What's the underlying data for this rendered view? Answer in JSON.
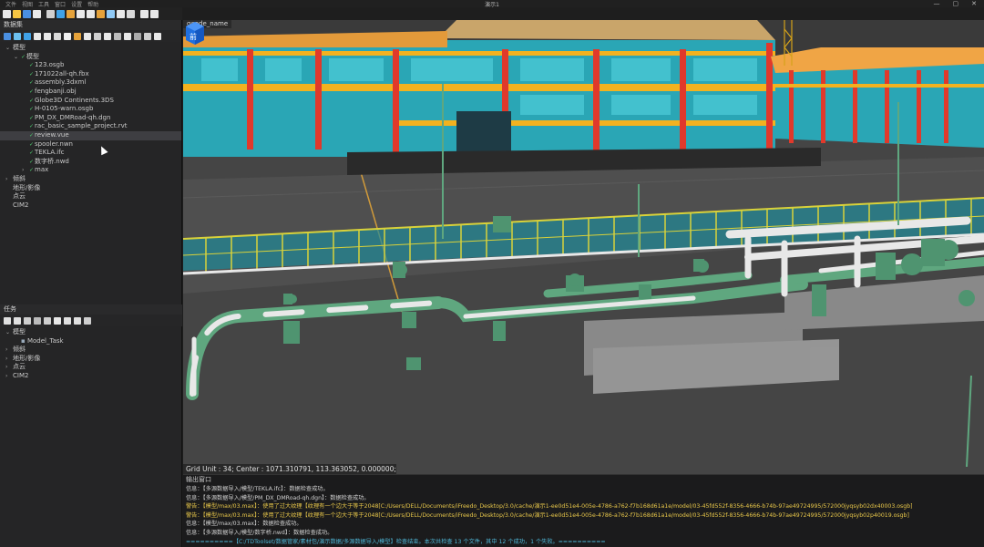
{
  "window": {
    "title": "演示1",
    "menus": [
      "文件",
      "视图",
      "工具",
      "窗口",
      "设置",
      "帮助"
    ],
    "controls": [
      "—",
      "▢",
      "✕"
    ]
  },
  "toolbar": {
    "icons": [
      "new-icon",
      "open-icon",
      "save-icon",
      "close-icon",
      "grid-icon",
      "globe-icon",
      "layers-icon",
      "doc-icon",
      "building-icon",
      "chart-icon",
      "image-icon",
      "edit-icon",
      "cube-icon",
      "settings-icon",
      "info-icon"
    ]
  },
  "dataset_panel": {
    "title": "数据集",
    "tree": [
      {
        "level": 0,
        "arrow": "⌄",
        "label": "模型"
      },
      {
        "level": 1,
        "arrow": "⌄",
        "label": "模型",
        "check": true
      },
      {
        "level": 2,
        "label": "123.osgb",
        "check": true
      },
      {
        "level": 2,
        "label": "171022all-qh.fbx",
        "check": true
      },
      {
        "level": 2,
        "label": "assembly.3dxml",
        "check": true
      },
      {
        "level": 2,
        "label": "fengbanji.obj",
        "check": true
      },
      {
        "level": 2,
        "label": "Globe3D Continents.3DS",
        "check": true
      },
      {
        "level": 2,
        "label": "H-0105-warn.osgb",
        "check": true
      },
      {
        "level": 2,
        "label": "PM_DX_DMRoad-qh.dgn",
        "check": true
      },
      {
        "level": 2,
        "label": "rac_basic_sample_project.rvt",
        "check": true
      },
      {
        "level": 2,
        "label": "review.vue",
        "check": true,
        "selected": true
      },
      {
        "level": 2,
        "label": "spooler.nwn",
        "check": true
      },
      {
        "level": 2,
        "label": "TEKLA.ifc",
        "check": true
      },
      {
        "level": 2,
        "label": "数字桥.nwd",
        "check": true
      },
      {
        "level": 2,
        "arrow": "›",
        "label": "max",
        "check": true
      },
      {
        "level": 0,
        "arrow": "›",
        "label": "倾斜"
      },
      {
        "level": 0,
        "arrow": "",
        "label": "地形/影像"
      },
      {
        "level": 0,
        "arrow": "",
        "label": "点云"
      },
      {
        "level": 0,
        "arrow": "",
        "label": "CIM2"
      }
    ]
  },
  "task_panel": {
    "title": "任务",
    "tree": [
      {
        "level": 0,
        "arrow": "⌄",
        "label": "模型"
      },
      {
        "level": 1,
        "arrow": "",
        "label": "Model_Task",
        "bullet": "▪"
      },
      {
        "level": 0,
        "arrow": "›",
        "label": "倾斜"
      },
      {
        "level": 0,
        "arrow": "›",
        "label": "地形/影像"
      },
      {
        "level": 0,
        "arrow": "›",
        "label": "点云"
      },
      {
        "level": 0,
        "arrow": "›",
        "label": "CIM2"
      }
    ]
  },
  "viewport": {
    "tab_label": "geode_name",
    "status": "Grid Unit : 34; Center : 1071.310791, 113.363052, 0.000000;",
    "navcube_face": "前"
  },
  "output": {
    "title": "输出窗口",
    "lines": [
      {
        "type": "info",
        "text": "信息：【多源数据导入/模型/TEKLA.ifc】：数据检查成功。"
      },
      {
        "type": "info",
        "text": "信息：【多源数据导入/模型/PM_DX_DMRoad-qh.dgn】：数据检查成功。"
      },
      {
        "type": "warn",
        "text": "警告：【模型/max/03.max】：使用了过大纹理【纹理有一个边大于等于2048[C:/Users/DELL/Documents/iFreedo_Desktop/3.0/cache/演示1-ee0d51e4-005e-4786-a762-f7b168d61a1e/model/03-45fd552f-8356-4666-b74b-97ae49724995/572000jyqsyb02dx40003.osgb]"
      },
      {
        "type": "warn",
        "text": "警告：【模型/max/03.max】：使用了过大纹理【纹理有一个边大于等于2048[C:/Users/DELL/Documents/iFreedo_Desktop/3.0/cache/演示1-ee0d51e4-005e-4786-a762-f7b168d61a1e/model/03-45fd552f-8356-4666-b74b-97ae49724995/572000jyqsyb02p40019.osgb]"
      },
      {
        "type": "info",
        "text": "信息：【模型/max/03.max】：数据检查成功。"
      },
      {
        "type": "info",
        "text": "信息：【多源数据导入/模型/数字桥.nwd】：数据检查成功。"
      },
      {
        "type": "done",
        "text": "==========【C:/TDToolset/数据管家/素材包/演示数据/多源数据导入/模型】检查结束。本次共检查 13 个文件，其中 12 个成功，1 个失败。=========="
      }
    ]
  },
  "colors": {
    "glass": "#2bb9c9",
    "column_red": "#e0392b",
    "beam_yellow": "#f2b21f",
    "roof_orange": "#f0a545",
    "pipe_green": "#5fa77f",
    "pipe_white": "#e8e8e8",
    "railing_yellow": "#d9d23a",
    "road": "#4a4a4a"
  }
}
